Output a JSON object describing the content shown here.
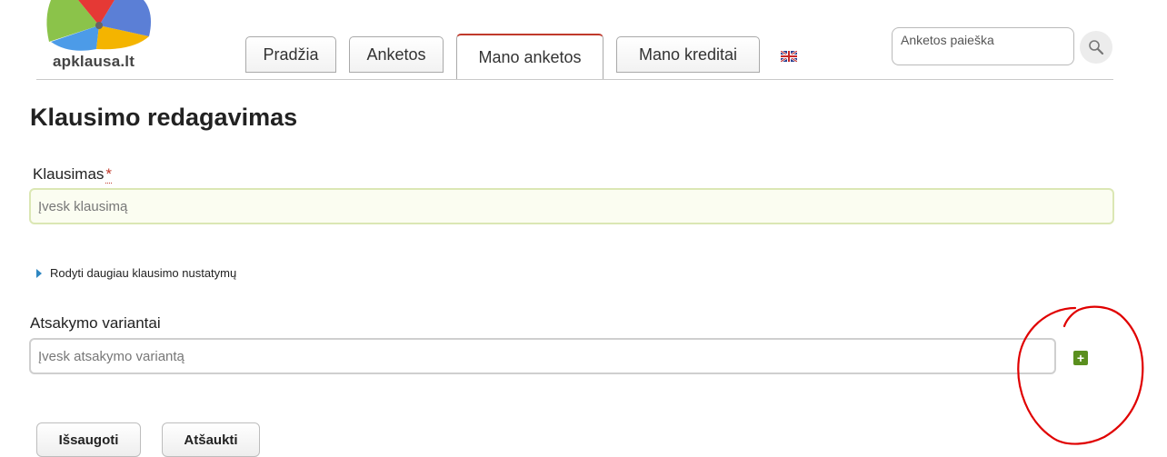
{
  "header": {
    "logo_text": "apklausa.lt",
    "tabs": [
      {
        "label": "Pradžia"
      },
      {
        "label": "Anketos"
      },
      {
        "label": "Mano anketos",
        "active": true
      },
      {
        "label": "Mano kreditai"
      }
    ],
    "language_flag": "uk-flag-icon",
    "search": {
      "placeholder": "Anketos paieška",
      "value": ""
    },
    "search_icon": "magnifier-icon"
  },
  "page": {
    "title": "Klausimo redagavimas",
    "question": {
      "label": "Klausimas",
      "required_mark": "*",
      "placeholder": "Įvesk klausimą",
      "value": ""
    },
    "more_settings_link": "Rodyti daugiau klausimo nustatymų",
    "answers": {
      "label": "Atsakymo variantai",
      "placeholder": "Įvesk atsakymo variantą",
      "value": "",
      "add_icon": "+"
    },
    "buttons": {
      "save": "Išsaugoti",
      "cancel": "Atšaukti"
    }
  },
  "colors": {
    "active_tab_accent": "#c0392b",
    "add_button": "#5a8f1e",
    "link_triangle": "#2e86c1",
    "annotation": "#e00000"
  }
}
